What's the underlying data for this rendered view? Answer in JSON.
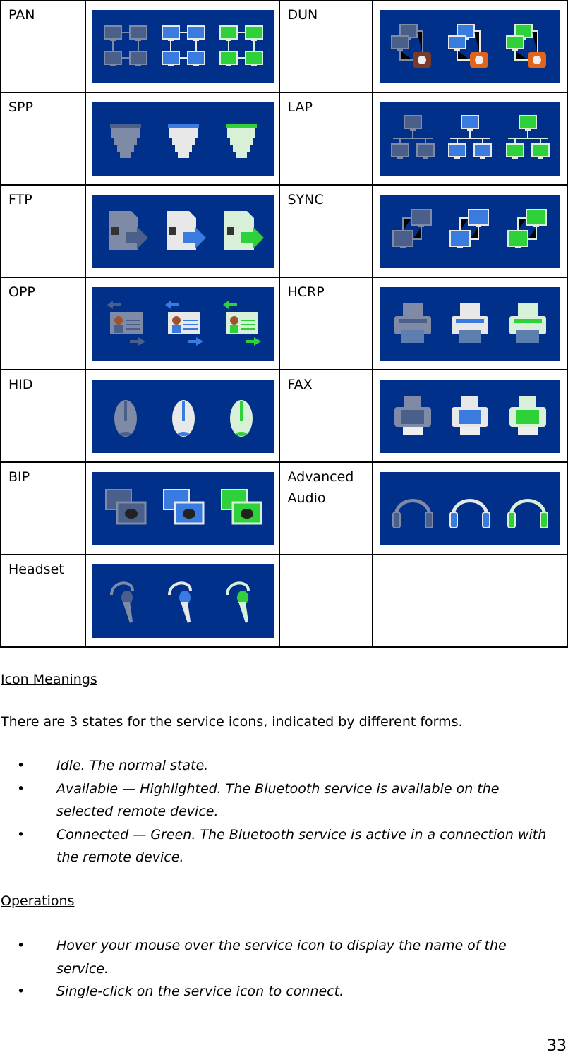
{
  "services": [
    {
      "name": "PAN",
      "icon": "pan-network-icon"
    },
    {
      "name": "DUN",
      "icon": "dialup-network-icon"
    },
    {
      "name": "SPP",
      "icon": "serial-port-icon"
    },
    {
      "name": "LAP",
      "icon": "lan-access-icon"
    },
    {
      "name": "FTP",
      "icon": "file-transfer-icon"
    },
    {
      "name": "SYNC",
      "icon": "sync-icon"
    },
    {
      "name": "OPP",
      "icon": "object-push-icon"
    },
    {
      "name": "HCRP",
      "icon": "printer-icon"
    },
    {
      "name": "HID",
      "icon": "mouse-icon"
    },
    {
      "name": "FAX",
      "icon": "fax-icon"
    },
    {
      "name": "BIP",
      "icon": "basic-imaging-icon"
    },
    {
      "name": "Advanced Audio",
      "name_line1": "Advanced",
      "name_line2": "Audio",
      "icon": "headphones-icon"
    },
    {
      "name": "Headset",
      "icon": "headset-icon"
    }
  ],
  "state_colors": {
    "idle": "#4a5f8a",
    "available": "#3a7be0",
    "connected": "#2fd13a",
    "panel_bg": "#00308a"
  },
  "icon_meanings": {
    "heading": "Icon Meanings",
    "intro": "There are 3 states for the service icons, indicated by different forms.",
    "bullets": [
      "Idle. The normal state.",
      "Available — Highlighted. The Bluetooth service is available on the selected remote device.",
      "Connected — Green. The Bluetooth service is active in a connection with the remote device."
    ]
  },
  "operations": {
    "heading": "Operations",
    "bullets": [
      "Hover your mouse over the service icon to display the name of the service.",
      "Single-click on the service icon to connect."
    ]
  },
  "page_number": "33"
}
